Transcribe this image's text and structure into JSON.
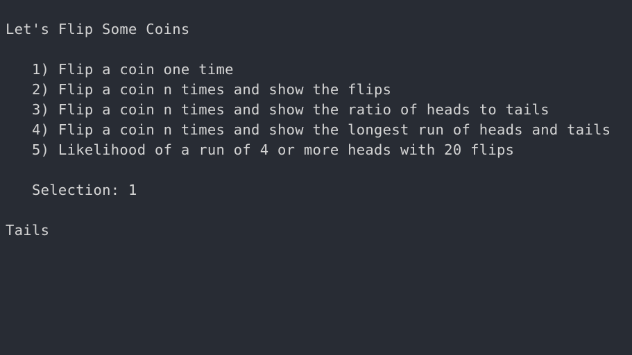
{
  "terminal": {
    "title_line": "Let's Flip Some Coins",
    "menu": [
      "1) Flip a coin one time",
      "2) Flip a coin n times and show the flips",
      "3) Flip a coin n times and show the ratio of heads to tails",
      "4) Flip a coin n times and show the longest run of heads and tails",
      "5) Likelihood of a run of 4 or more heads with 20 flips"
    ],
    "selection_prompt": "Selection: 1",
    "result": "Tails",
    "colors": {
      "background": "#282c34",
      "text": "#d4d4d4"
    }
  }
}
